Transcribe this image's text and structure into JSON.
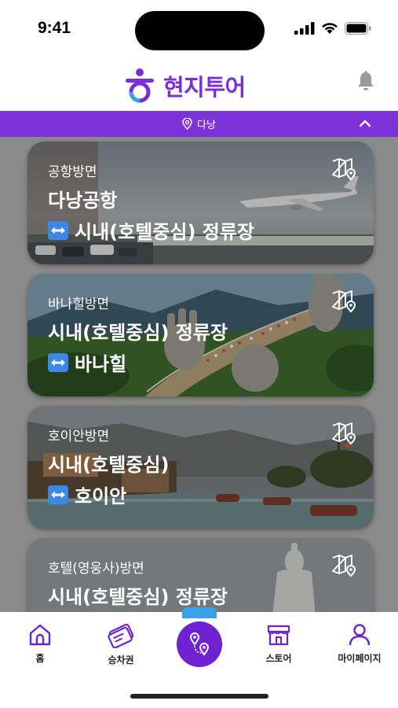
{
  "status": {
    "time": "9:41"
  },
  "header": {
    "app_name": "현지투어"
  },
  "location": {
    "name": "다낭"
  },
  "routes": [
    {
      "subtitle": "공항방면",
      "line1": "다낭공항",
      "line2": "시내(호텔중심) 정류장"
    },
    {
      "subtitle": "바나힐방면",
      "line1": "시내(호텔중심) 정류장",
      "line2": "바나힐"
    },
    {
      "subtitle": "호이안방면",
      "line1": "시내(호텔중심)",
      "line2": "호이안"
    },
    {
      "subtitle": "호텔(영웅사)방면",
      "line1": "시내(호텔중심) 정류장",
      "line2": ""
    }
  ],
  "nav": {
    "home": "홈",
    "ticket": "승차권",
    "store": "스토어",
    "mypage": "마이페이지"
  },
  "colors": {
    "brand": "#7d33d9",
    "accent_blue": "#3a87e8"
  }
}
